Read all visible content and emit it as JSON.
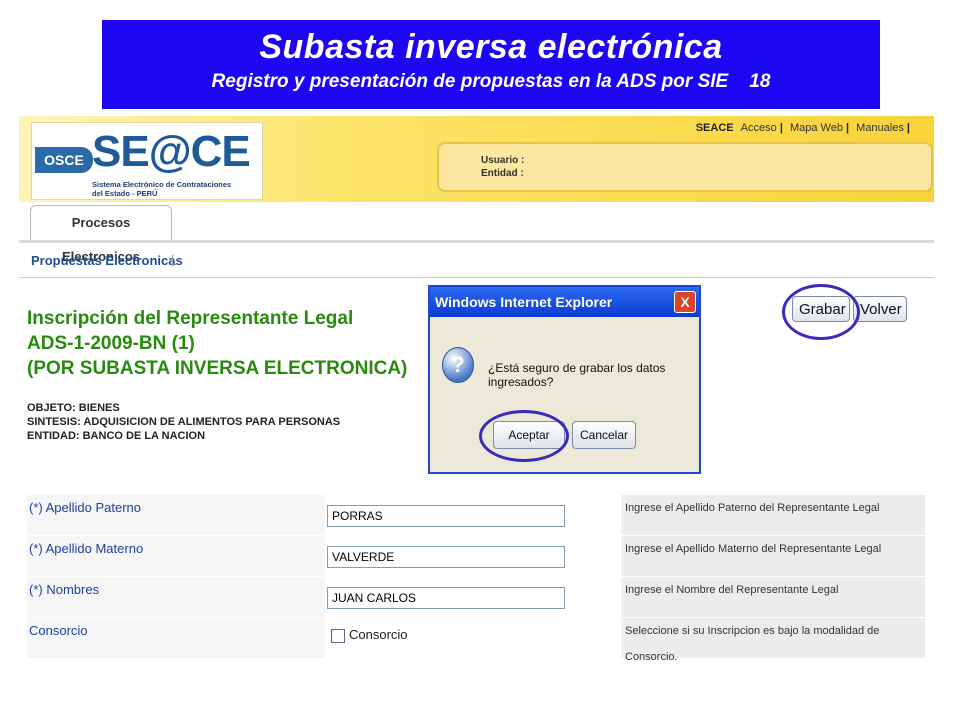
{
  "slide": {
    "title": "Subasta inversa electrónica",
    "subtitle": "Registro y presentación de propuestas en la ADS por SIE    18"
  },
  "header": {
    "osce": "OSCE",
    "logo_word": "SE@CE",
    "logo_caption_1": "Sistema Electrónico de Contrataciones",
    "logo_caption_2": "del Estado - PERÚ",
    "links": {
      "seace": "SEACE",
      "acceso": "Acceso",
      "mapa": "Mapa Web",
      "manuales": "Manuales",
      "sep": "|"
    },
    "usuario_label": "Usuario :",
    "entidad_label": "Entidad :"
  },
  "nav": {
    "tab": "Procesos Electronicos",
    "subnav": "Propuestas Electronicas",
    "sep": "|"
  },
  "page": {
    "title_1": "Inscripción del Representante Legal",
    "title_2": "ADS-1-2009-BN (1)",
    "title_3": "(POR SUBASTA INVERSA ELECTRONICA)",
    "objeto": "OBJETO: BIENES",
    "sintesis": "SINTESIS: ADQUISICION DE ALIMENTOS PARA PERSONAS",
    "entidad": "ENTIDAD: BANCO DE LA NACION"
  },
  "toolbar": {
    "grabar": "Grabar",
    "volver": "Volver"
  },
  "dialog": {
    "title": "Windows Internet Explorer",
    "close": "X",
    "icon": "?",
    "message": "¿Está seguro de grabar los datos ingresados?",
    "accept": "Aceptar",
    "cancel": "Cancelar"
  },
  "form": {
    "rows": [
      {
        "label": "(*) Apellido Paterno",
        "value": "PORRAS",
        "help": "Ingrese el Apellido Paterno del Representante Legal"
      },
      {
        "label": "(*) Apellido Materno",
        "value": "VALVERDE",
        "help": "Ingrese el Apellido Materno del Representante Legal"
      },
      {
        "label": "(*) Nombres",
        "value": "JUAN CARLOS",
        "help": "Ingrese el Nombre del Representante Legal"
      }
    ],
    "consorcio": {
      "label": "Consorcio",
      "checkbox_label": "Consorcio",
      "help": "Seleccione si su Inscripcion es bajo la modalidad de Consorcio."
    }
  }
}
